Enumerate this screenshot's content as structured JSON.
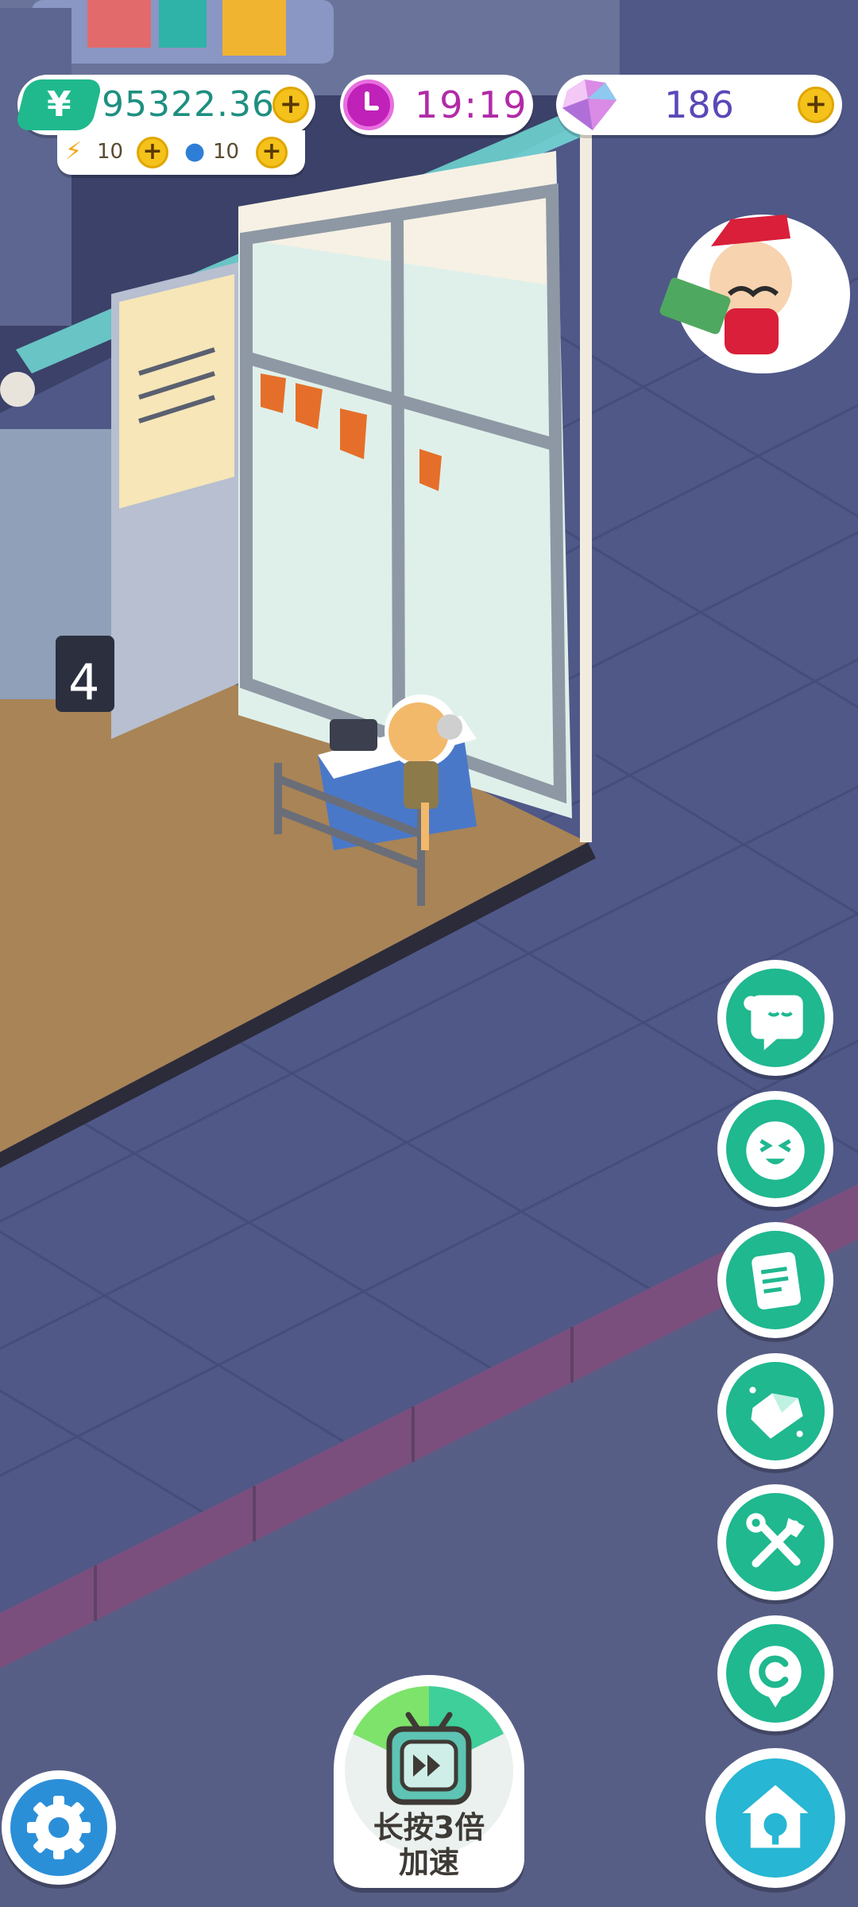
{
  "hud": {
    "money": {
      "icon": "yuan-icon",
      "symbol": "¥",
      "value": "95322.36",
      "plus": "+"
    },
    "energy": {
      "icon": "lightning-icon",
      "value": "10",
      "plus": "+"
    },
    "water": {
      "icon": "water-drop-icon",
      "value": "10",
      "plus": "+"
    },
    "time": {
      "icon": "clock-icon",
      "value": "19:19"
    },
    "gems": {
      "icon": "gem-icon",
      "value": "186",
      "plus": "+"
    }
  },
  "scene": {
    "counter_number": "4"
  },
  "side_buttons": [
    {
      "name": "chat-bubble-button",
      "icon": "chat-ghost-icon"
    },
    {
      "name": "emoji-face-button",
      "icon": "laughing-face-icon"
    },
    {
      "name": "notes-button",
      "icon": "note-icon"
    },
    {
      "name": "gem-shop-button",
      "icon": "diamond-icon"
    },
    {
      "name": "tools-button",
      "icon": "wrench-axe-icon"
    },
    {
      "name": "coin-button",
      "icon": "c-coin-icon"
    }
  ],
  "speed_button": {
    "label_line1": "长按3倍",
    "label_line2": "加速",
    "icon": "tv-fast-forward-icon"
  },
  "settings_button": {
    "icon": "gear-icon"
  },
  "home_button": {
    "icon": "house-wrench-icon"
  },
  "merchant": {
    "icon": "mustache-merchant-icon"
  },
  "colors": {
    "accent_green": "#1fb88f",
    "money_text": "#1e8f80",
    "time_purple": "#b12aa8",
    "gem_purple": "#5a48b8",
    "coin_yellow": "#f4c21a",
    "ground": "#4f5887",
    "floor_wood": "#a98456"
  }
}
